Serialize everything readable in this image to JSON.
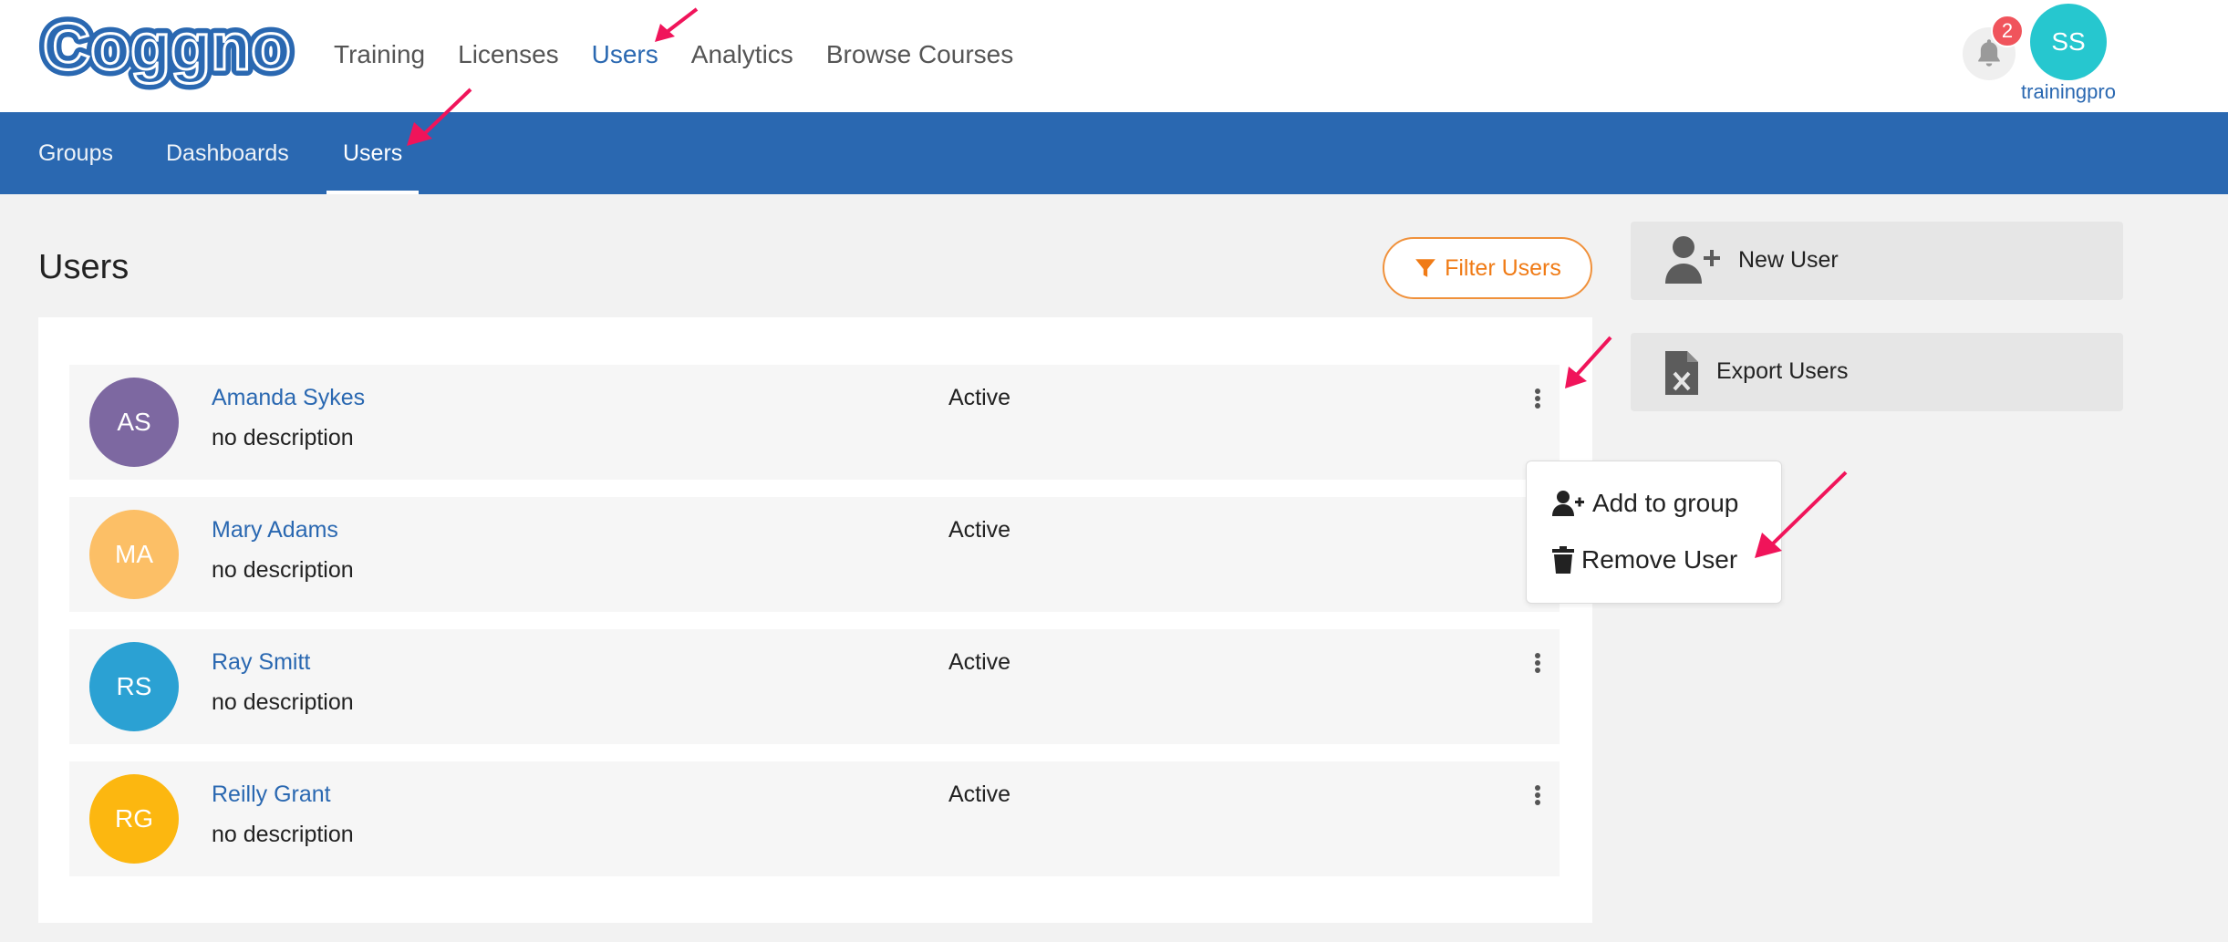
{
  "header": {
    "logo_text": "Coggno",
    "nav": [
      {
        "label": "Training"
      },
      {
        "label": "Licenses"
      },
      {
        "label": "Users",
        "active": true
      },
      {
        "label": "Analytics"
      },
      {
        "label": "Browse Courses"
      }
    ],
    "notifications_count": "2",
    "profile_initials": "SS",
    "profile_name": "trainingpro"
  },
  "subnav": {
    "tabs": [
      {
        "label": "Groups"
      },
      {
        "label": "Dashboards"
      },
      {
        "label": "Users",
        "active": true
      }
    ]
  },
  "main": {
    "title": "Users",
    "filter_label": "Filter Users",
    "users": [
      {
        "initials": "AS",
        "name": "Amanda Sykes",
        "description": "no description",
        "status": "Active",
        "color": "#7d68a1"
      },
      {
        "initials": "MA",
        "name": "Mary Adams",
        "description": "no description",
        "status": "Active",
        "color": "#fcbf66"
      },
      {
        "initials": "RS",
        "name": "Ray Smitt",
        "description": "no description",
        "status": "Active",
        "color": "#2ba1d3"
      },
      {
        "initials": "RG",
        "name": "Reilly Grant",
        "description": "no description",
        "status": "Active",
        "color": "#fcb710"
      }
    ]
  },
  "actions": {
    "new_user": "New User",
    "export_users": "Export Users"
  },
  "row_menu": {
    "add_to_group": "Add to group",
    "remove_user": "Remove User"
  },
  "colors": {
    "brand_blue": "#2a68b1",
    "accent_orange": "#f07b16",
    "annotation_arrow": "#f0145a"
  }
}
